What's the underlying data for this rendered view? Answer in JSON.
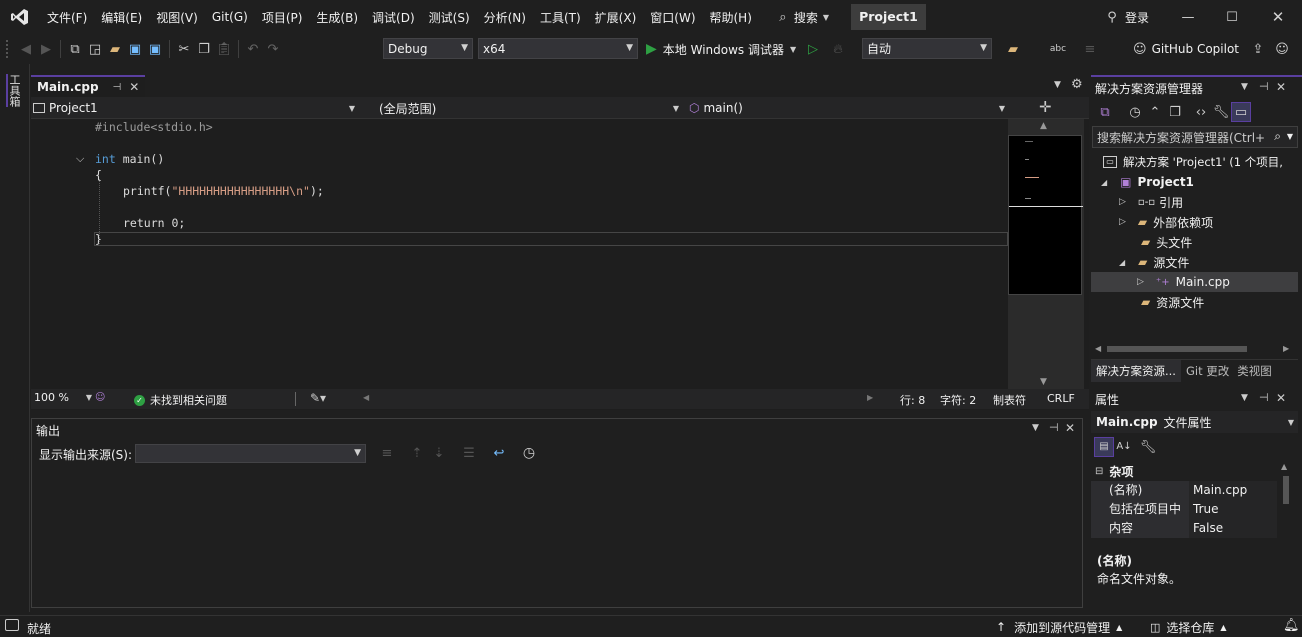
{
  "menu": {
    "items": [
      "文件(F)",
      "编辑(E)",
      "视图(V)",
      "Git(G)",
      "项目(P)",
      "生成(B)",
      "调试(D)",
      "测试(S)",
      "分析(N)",
      "工具(T)",
      "扩展(X)",
      "窗口(W)",
      "帮助(H)"
    ],
    "search_label": "搜索",
    "project_name": "Project1",
    "login_label": "登录"
  },
  "toolbar": {
    "config": "Debug",
    "platform": "x64",
    "run_label": "本地 Windows 调试器",
    "auto_label": "自动",
    "copilot_label": "GitHub Copilot"
  },
  "left_toolstrip": {
    "label": "工具箱"
  },
  "editor": {
    "tab_label": "Main.cpp",
    "nav_project": "Project1",
    "nav_scope": "(全局范围)",
    "nav_function": "main()",
    "lines": {
      "include": "#include<stdio.h>",
      "main_kw": "int",
      "main_rest": " main()",
      "open_brace": "{",
      "printf_a": "printf(",
      "printf_str": "\"HHHHHHHHHHHHHHHH\\n\"",
      "printf_b": ");",
      "return_kw": "return",
      "return_rest": " 0;",
      "close_brace": "}"
    },
    "status": {
      "zoom": "100 %",
      "issues": "未找到相关问题",
      "line": "行: 8",
      "char": "字符: 2",
      "tab_mode": "制表符",
      "eol": "CRLF"
    }
  },
  "output": {
    "title": "输出",
    "source_label": "显示输出来源(S):"
  },
  "solution_explorer": {
    "title": "解决方案资源管理器",
    "search_placeholder": "搜索解决方案资源管理器(Ctrl+;)",
    "solution": "解决方案 'Project1' (1 个项目,",
    "project": "Project1",
    "references": "引用",
    "external_deps": "外部依赖项",
    "headers": "头文件",
    "sources": "源文件",
    "main_cpp": "Main.cpp",
    "resources": "资源文件",
    "tabs": [
      "解决方案资源...",
      "Git 更改",
      "类视图"
    ]
  },
  "properties": {
    "title": "属性",
    "object_name": "Main.cpp",
    "object_type": "文件属性",
    "category": "杂项",
    "rows": [
      {
        "name": "(名称)",
        "value": "Main.cpp"
      },
      {
        "name": "包括在项目中",
        "value": "True"
      },
      {
        "name": "内容",
        "value": "False"
      }
    ],
    "desc_title": "(名称)",
    "desc_text": "命名文件对象。"
  },
  "statusbar": {
    "ready": "就绪",
    "add_source": "添加到源代码管理",
    "select_repo": "选择仓库"
  },
  "colors": {
    "accent": "#5a3fa0",
    "run_green": "#2ea043",
    "background": "#1f1f1f"
  }
}
